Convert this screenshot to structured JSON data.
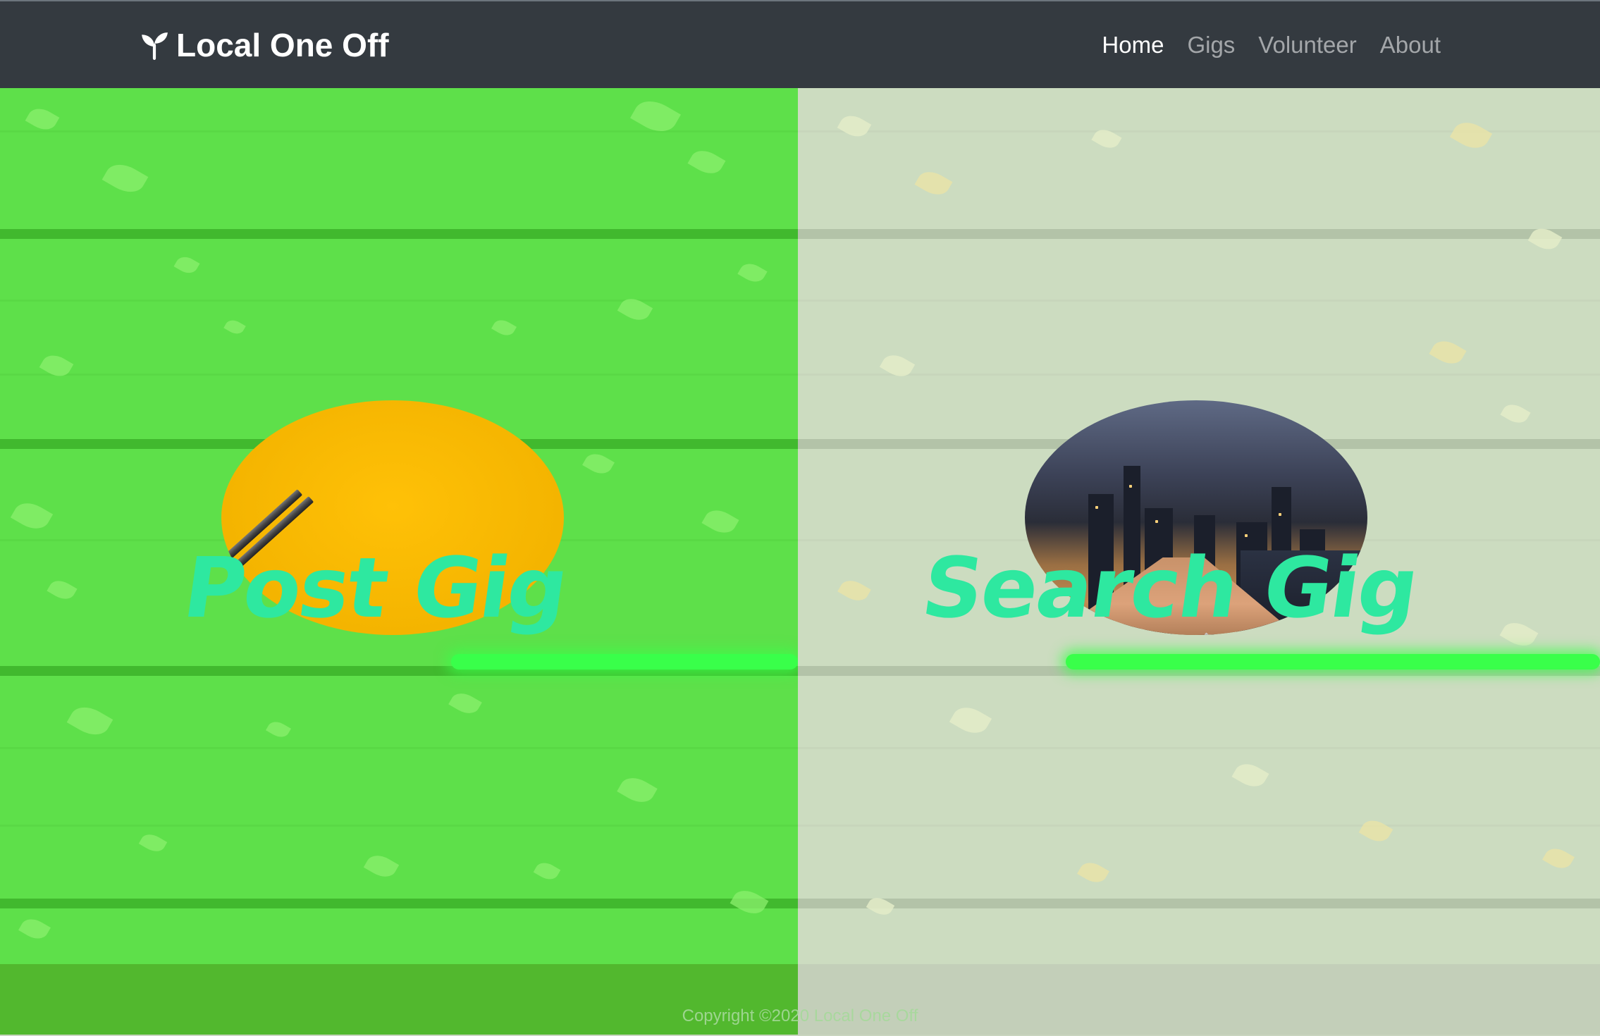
{
  "brand": {
    "name": "Local One Off",
    "icon": "seedling-icon"
  },
  "nav": {
    "items": [
      {
        "label": "Home",
        "active": true
      },
      {
        "label": "Gigs",
        "active": false
      },
      {
        "label": "Volunteer",
        "active": false
      },
      {
        "label": "About",
        "active": false
      }
    ]
  },
  "hero": {
    "left": {
      "label": "Post Gig",
      "image": "pencils-on-yellow"
    },
    "right": {
      "label": "Search Gig",
      "image": "city-boardwalk-night"
    }
  },
  "footer": {
    "copyright": "Copyright ©2020 Local One Off"
  },
  "colors": {
    "navbar": "#343a40",
    "left_overlay": "#5ee04a",
    "right_overlay": "#ccdcc0",
    "cta_text": "#2ee8a0",
    "accent_glow": "#39ff4a"
  }
}
